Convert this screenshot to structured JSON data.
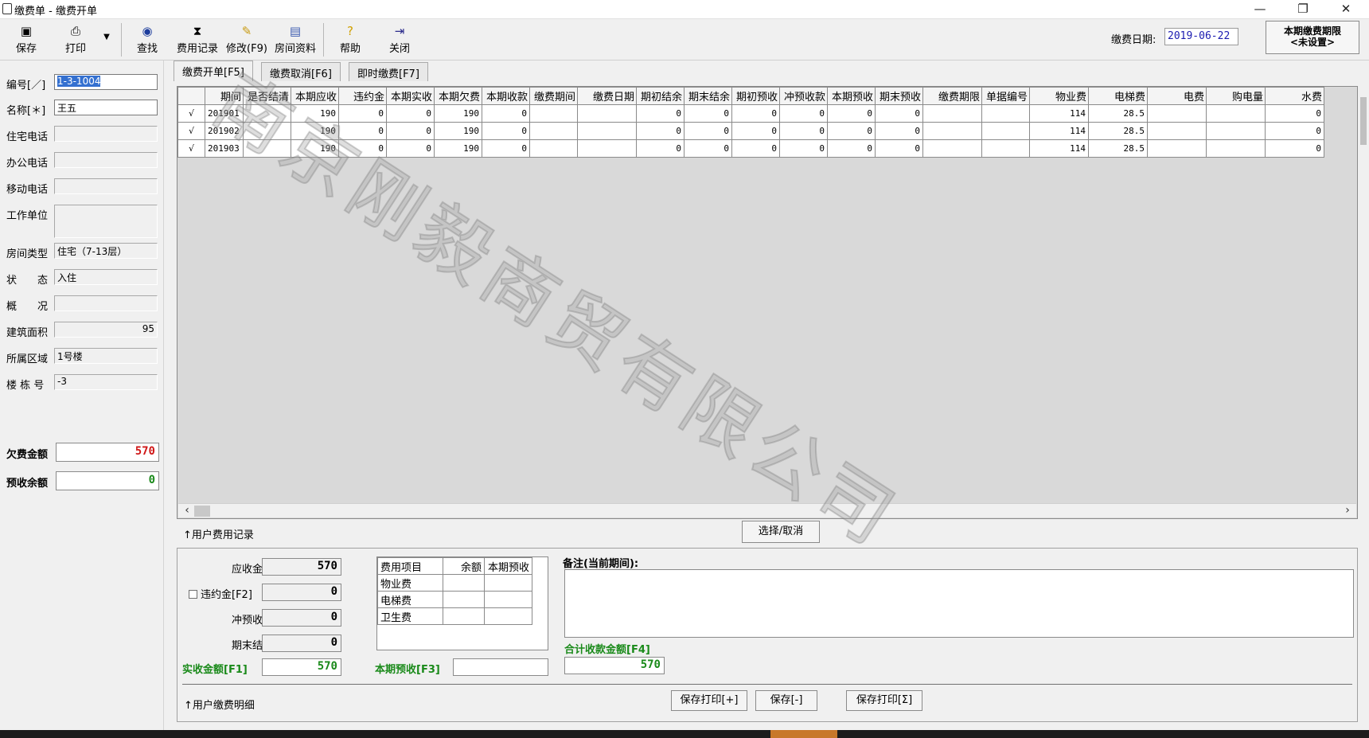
{
  "window": {
    "title": "缴费单 - 缴费开单",
    "controls": [
      "—",
      "❐",
      "✕"
    ]
  },
  "toolbar": {
    "buttons": [
      {
        "label": "保存",
        "icon": "floppy-icon"
      },
      {
        "label": "打印",
        "icon": "printer-icon"
      },
      {
        "label": "查找",
        "icon": "binoculars-icon"
      },
      {
        "label": "费用记录",
        "icon": "records-icon"
      },
      {
        "label": "修改(F9)",
        "icon": "edit-icon"
      },
      {
        "label": "房间资料",
        "icon": "room-info-icon"
      },
      {
        "label": "帮助",
        "icon": "help-icon"
      },
      {
        "label": "关闭",
        "icon": "exit-icon"
      }
    ],
    "dropdown_arrow": "▼",
    "pay_date_label": "缴费日期:",
    "pay_date_value": "2019-06-22",
    "period_limit_line1": "本期缴费期限",
    "period_limit_line2": "<未设置>"
  },
  "left_panel": {
    "fields": [
      {
        "label": "编号[／]",
        "value": "1-3-1004"
      },
      {
        "label": "名称[＊]",
        "value": "王五"
      },
      {
        "label": "住宅电话",
        "value": ""
      },
      {
        "label": "办公电话",
        "value": ""
      },
      {
        "label": "移动电话",
        "value": ""
      },
      {
        "label": "工作单位",
        "value": ""
      },
      {
        "label": "房间类型",
        "value": "住宅（7-13层）"
      },
      {
        "label": "状　　态",
        "value": "入住"
      },
      {
        "label": "概　　况",
        "value": ""
      },
      {
        "label": "建筑面积",
        "value": "95"
      },
      {
        "label": "所属区域",
        "value": "1号楼"
      },
      {
        "label": "楼 栋 号",
        "value": "-3"
      }
    ],
    "arrears_label": "欠费金额",
    "arrears_value": "570",
    "prepaid_label": "预收余额",
    "prepaid_value": "0",
    "colors": {
      "arrears": "#d01818",
      "prepaid": "#1a8a1a"
    }
  },
  "tabs": [
    "缴费开单[F5]",
    "缴费取消[F6]",
    "即时缴费[F7]"
  ],
  "grid": {
    "columns": [
      "",
      "期间",
      "是否结清",
      "本期应收",
      "违约金",
      "本期实收",
      "本期欠费",
      "本期收款",
      "缴费期间",
      "缴费日期",
      "期初结余",
      "期末结余",
      "期初预收",
      "冲预收款",
      "本期预收",
      "期末预收",
      "缴费期限",
      "单据编号",
      "物业费",
      "电梯费",
      "电费",
      "购电量",
      "水费"
    ],
    "rows": [
      [
        "√",
        "201901",
        "",
        "190",
        "0",
        "0",
        "190",
        "0",
        "",
        "",
        "0",
        "0",
        "0",
        "0",
        "0",
        "0",
        "",
        "",
        "114",
        "28.5",
        "",
        "",
        "0"
      ],
      [
        "√",
        "201902",
        "",
        "190",
        "0",
        "0",
        "190",
        "0",
        "",
        "",
        "0",
        "0",
        "0",
        "0",
        "0",
        "0",
        "",
        "",
        "114",
        "28.5",
        "",
        "",
        "0"
      ],
      [
        "√",
        "201903",
        "",
        "190",
        "0",
        "0",
        "190",
        "0",
        "",
        "",
        "0",
        "0",
        "0",
        "0",
        "0",
        "0",
        "",
        "",
        "114",
        "28.5",
        "",
        "",
        "0"
      ]
    ]
  },
  "history_label": "↑用户费用记录",
  "select_cancel_label": "选择/取消",
  "bottom": {
    "receivable_label": "应收金额",
    "receivable_value": "570",
    "penalty_label": "违约金[F2]",
    "penalty_value": "0",
    "offset_label": "冲预收款",
    "offset_value": "0",
    "balance_label": "期末结余",
    "balance_value": "0",
    "actual_label": "实收金额[F1]",
    "actual_value": "570",
    "fee_table_headers": [
      "费用项目",
      "余额",
      "本期预收"
    ],
    "fee_items": [
      "物业费",
      "电梯费",
      "卫生费"
    ],
    "prepay_label": "本期预收[F3]",
    "prepay_value": "",
    "remark_label": "备注(当前期间):",
    "remark_value": "",
    "total_label": "合计收款金额[F4]",
    "total_value": "570",
    "detail_label": "↑用户缴费明细",
    "save_print_plus": "保存打印[+]",
    "save_minus": "保存[-]",
    "save_print_sigma": "保存打印[Σ]"
  },
  "watermark": "南京刚毅商贸有限公司"
}
